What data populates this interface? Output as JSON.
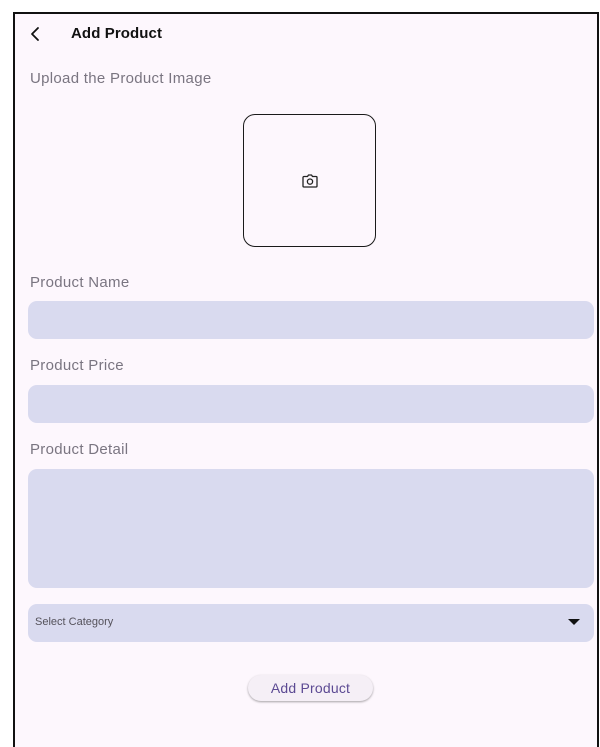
{
  "app_bar": {
    "title": "Add Product",
    "back_icon": "chevron-left-icon"
  },
  "image_upload": {
    "label": "Upload the Product Image",
    "icon": "camera-icon"
  },
  "form": {
    "name": {
      "label": "Product Name",
      "value": "",
      "placeholder": ""
    },
    "price": {
      "label": "Product Price",
      "value": "",
      "placeholder": ""
    },
    "detail": {
      "label": "Product Detail",
      "value": "",
      "placeholder": ""
    },
    "category": {
      "selected": "Select Category",
      "icon": "dropdown-arrow-icon"
    }
  },
  "submit_button": {
    "label": "Add Product"
  },
  "colors": {
    "background": "#fdf7fd",
    "field_fill": "#d9daef",
    "label_text": "#7a7581",
    "button_text": "#5c4a93"
  }
}
